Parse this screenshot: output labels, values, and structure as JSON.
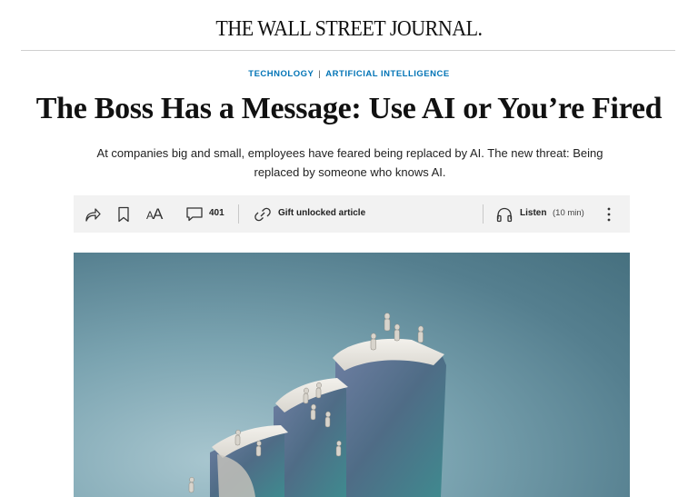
{
  "masthead": {
    "title": "THE WALL STREET JOURNAL."
  },
  "breadcrumb": {
    "section": "TECHNOLOGY",
    "separator": "|",
    "subsection": "ARTIFICIAL INTELLIGENCE"
  },
  "article": {
    "headline": "The Boss Has a Message: Use AI or You’re Fired",
    "dek": "At companies big and small, employees have feared being replaced by AI. The new threat: Being replaced by someone who knows AI."
  },
  "toolbar": {
    "share_icon": "share-icon",
    "bookmark_icon": "bookmark-icon",
    "fontsize_label": "AA",
    "comment_icon": "comment-icon",
    "comment_count": "401",
    "gift_icon": "link-icon",
    "gift_label": "Gift unlocked article",
    "listen_icon": "headphones-icon",
    "listen_label": "Listen",
    "listen_duration": "(10 min)",
    "more_icon": "more-vertical-icon"
  },
  "hero": {
    "image_icon": "article-illustration",
    "colors": {
      "background": "#5f8b9a",
      "sculpture": "#e8e4dc",
      "pattern": "#5a6b8a"
    }
  },
  "colors": {
    "accent": "#0274b6",
    "toolbar_bg": "#f2f2f2"
  }
}
